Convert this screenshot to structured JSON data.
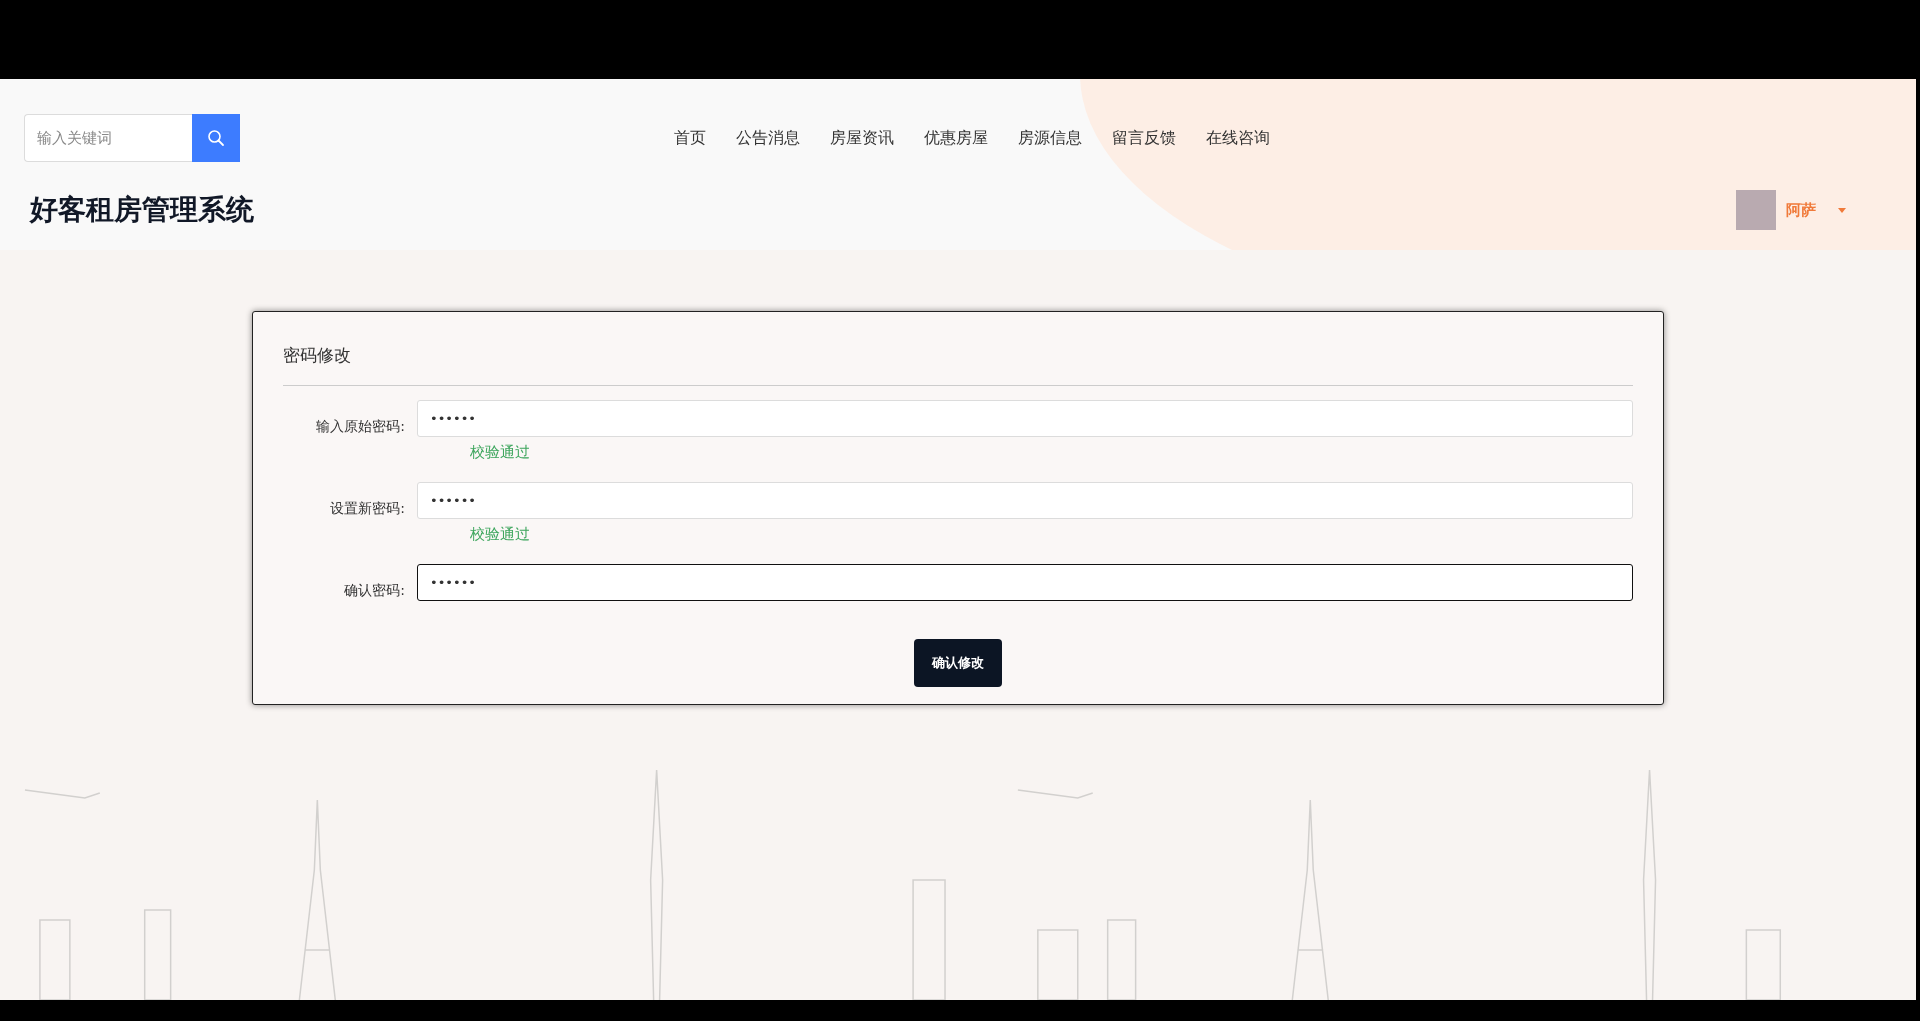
{
  "header": {
    "search": {
      "placeholder": "输入关键词"
    },
    "site_title": "好客租房管理系统",
    "nav": [
      {
        "label": "首页"
      },
      {
        "label": "公告消息"
      },
      {
        "label": "房屋资讯"
      },
      {
        "label": "优惠房屋"
      },
      {
        "label": "房源信息"
      },
      {
        "label": "留言反馈"
      },
      {
        "label": "在线咨询"
      }
    ],
    "user": {
      "name": "阿萨"
    }
  },
  "form": {
    "title": "密码修改",
    "fields": [
      {
        "label": "输入原始密码:",
        "value": "••••••",
        "focused": false,
        "message": "校验通过"
      },
      {
        "label": "设置新密码:",
        "value": "••••••",
        "focused": false,
        "message": "校验通过"
      },
      {
        "label": "确认密码:",
        "value": "••••••",
        "focused": true
      }
    ],
    "submit": "确认修改"
  }
}
